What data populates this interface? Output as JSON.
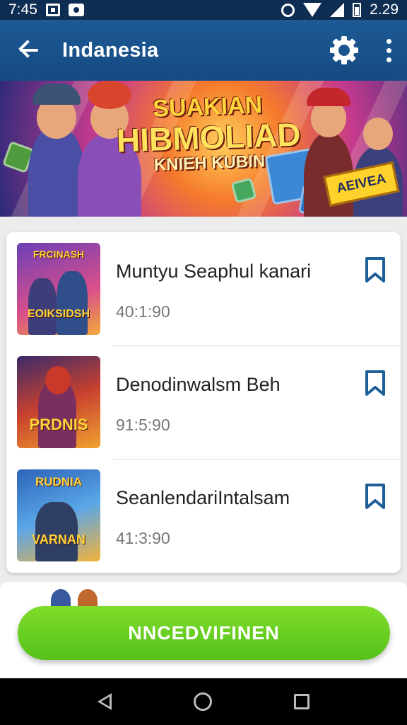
{
  "status_bar": {
    "time": "7:45",
    "battery_percent": "2.29",
    "icons": [
      "screen-record-icon",
      "picture-icon",
      "alarm-icon",
      "wifi-icon",
      "signal-icon",
      "battery-icon"
    ]
  },
  "app_bar": {
    "title": "Indanesia",
    "back_icon": "arrow-left-icon",
    "settings_icon": "gear-icon",
    "menu_icon": "more-vertical-icon"
  },
  "banner": {
    "line1": "SUAKIAN",
    "line2": "HIBMOLIAD",
    "line3": "KNIEH KUBIN",
    "badge": "AEIVEA"
  },
  "list": {
    "items": [
      {
        "thumb_top": "FRCINASH",
        "thumb_bottom": "EOIKSIDSH",
        "title": "Muntyu Seaphul kanari",
        "time": "40:1:90",
        "bookmark_icon": "bookmark-icon"
      },
      {
        "thumb_top": "",
        "thumb_bottom": "PRDNIS",
        "title": "Denodinwalsm Beh",
        "time": "91:5:90",
        "bookmark_icon": "bookmark-icon"
      },
      {
        "thumb_top": "RUDNIA",
        "thumb_bottom": "VARNAN",
        "title": "SeanlendariIntalsam",
        "time": "41:3:90",
        "bookmark_icon": "bookmark-icon"
      }
    ]
  },
  "cta": {
    "label": "NNCEDVIFINEN"
  },
  "nav_bar": {
    "icons": [
      "nav-back-icon",
      "nav-home-icon",
      "nav-recents-icon"
    ]
  },
  "colors": {
    "app_bar": "#1d5a95",
    "status_bar": "#0e2d52",
    "accent_bookmark": "#1f5f97",
    "cta_green": "#6acf22"
  }
}
